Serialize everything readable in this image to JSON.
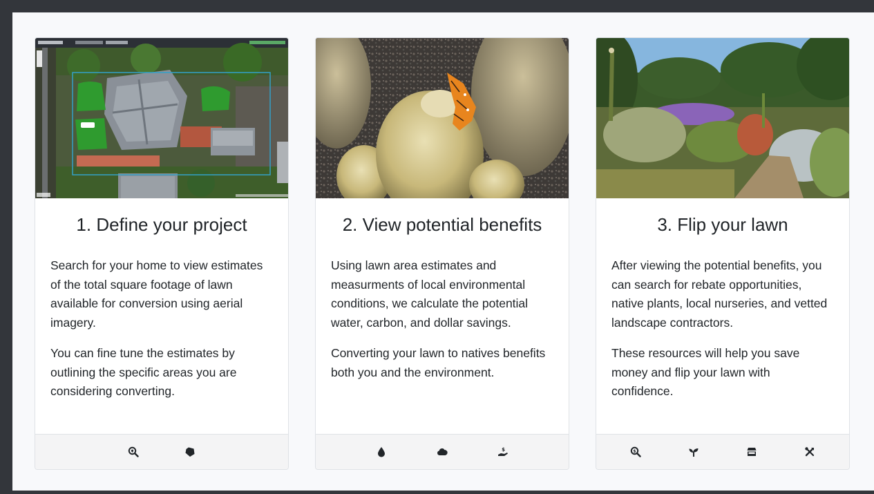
{
  "cards": [
    {
      "title": "1. Define your project",
      "image_alt": "Aerial satellite view of a house with highlighted green lawn areas",
      "paragraphs": [
        "Search for your home to view estimates of the total square footage of lawn available for conversion using aerial imagery.",
        "You can fine tune the estimates by outlining the specific areas you are considering converting."
      ],
      "footer_icons": [
        "search-location-icon",
        "draw-polygon-icon"
      ]
    },
    {
      "title": "2. View potential benefits",
      "image_alt": "Orange butterfly resting on a spiny golden barrel cactus",
      "paragraphs": [
        "Using lawn area estimates and measurments of local environmental conditions, we calculate the potential water, carbon, and dollar savings.",
        "Converting your lawn to natives benefits both you and the environment."
      ],
      "footer_icons": [
        "water-drop-icon",
        "cloud-icon",
        "hand-holding-usd-icon"
      ]
    },
    {
      "title": "3. Flip your lawn",
      "image_alt": "Garden with native plants, lavender and silver shrubs along a path",
      "paragraphs": [
        "After viewing the potential benefits, you can search for rebate opportunities, native plants, local nurseries, and vetted landscape contractors.",
        "These resources will help you save money and flip your lawn with confidence."
      ],
      "footer_icons": [
        "search-dollar-icon",
        "seedling-icon",
        "store-icon",
        "tools-icon"
      ]
    }
  ]
}
